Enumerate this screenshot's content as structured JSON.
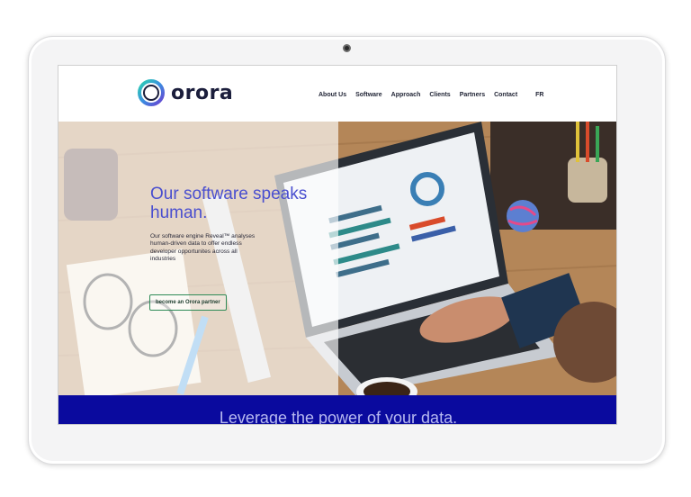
{
  "site": {
    "logo_text": "orora",
    "nav": [
      {
        "label": "About Us"
      },
      {
        "label": "Software"
      },
      {
        "label": "Approach"
      },
      {
        "label": "Clients"
      },
      {
        "label": "Partners"
      },
      {
        "label": "Contact"
      }
    ],
    "language": "FR"
  },
  "hero": {
    "heading": "Our software speaks human.",
    "body": "Our software engine Reveal™ analyses human-driven data to offer endless developer opportunites across all industries",
    "cta_label": "become an Orora partner"
  },
  "band": {
    "text": "Leverage the power of your data."
  },
  "colors": {
    "brand_blue": "#0a0a9e",
    "heading_purple": "#4a4fcf",
    "cta_green": "#2e8b57",
    "logo_dark": "#1b1e3c"
  },
  "icons": [
    "orora-logo-icon",
    "camera-icon"
  ]
}
